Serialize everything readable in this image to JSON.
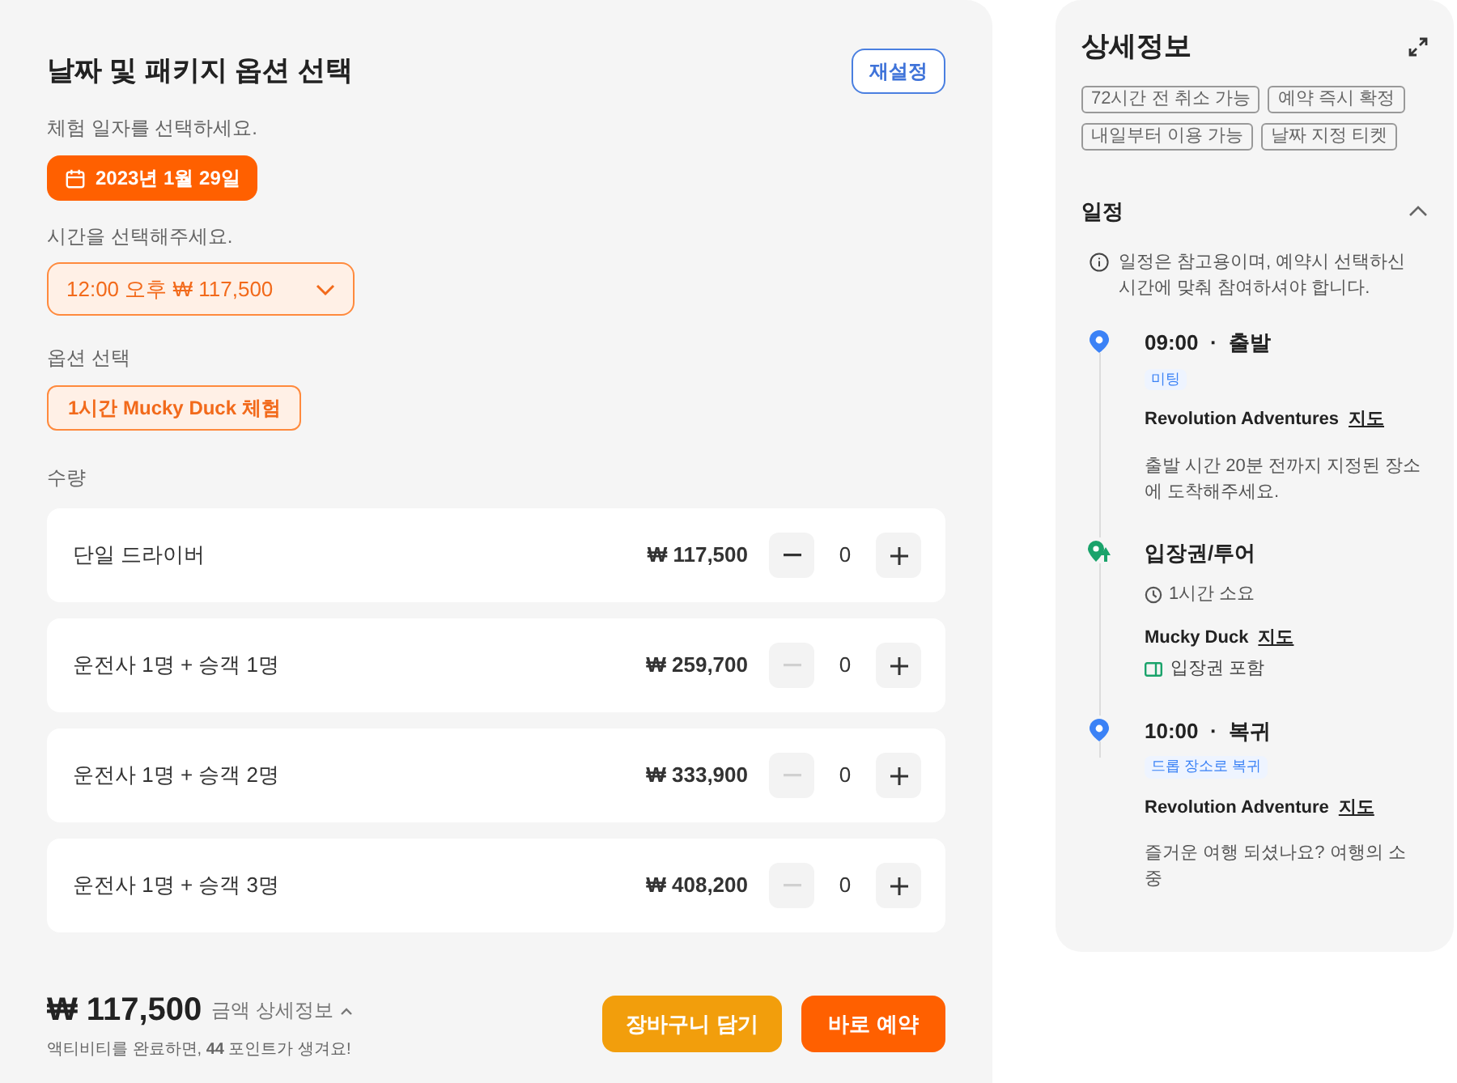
{
  "booking": {
    "title": "날짜 및 패키지 옵션 선택",
    "reset_button": "재설정",
    "date_label": "체험 일자를 선택하세요.",
    "date": "2023년 1월 29일",
    "time_label": "시간을 선택해주세요.",
    "time_select": "12:00 오후 ₩ 117,500",
    "option_label": "옵션 선택",
    "options": [
      {
        "label": "1시간 Mucky Duck 체험",
        "selected": true
      }
    ],
    "quantity_label": "수량",
    "quantities": [
      {
        "name": "단일 드라이버",
        "price": "₩ 117,500",
        "count": "0",
        "minus_disabled": false
      },
      {
        "name": "운전사 1명 + 승객 1명",
        "price": "₩ 259,700",
        "count": "0",
        "minus_disabled": true
      },
      {
        "name": "운전사 1명 + 승객 2명",
        "price": "₩ 333,900",
        "count": "0",
        "minus_disabled": true
      },
      {
        "name": "운전사 1명 + 승객 3명",
        "price": "₩ 408,200",
        "count": "0",
        "minus_disabled": true
      }
    ],
    "total": "₩ 117,500",
    "price_details": "금액 상세정보",
    "points_note": "액티비티를 완료하면, **44** 포인트가 생겨요!",
    "cart_button": "장바구니 담기",
    "book_button": "바로 예약"
  },
  "details": {
    "title": "상세정보",
    "tags": [
      "72시간 전 취소 가능",
      "예약 즉시 확정",
      "내일부터 이용 가능",
      "날짜 지정 티켓"
    ],
    "schedule_title": "일정",
    "schedule_expanded": true,
    "notice": "일정은 참고용이며, 예약시 선택하신 시간에 맞춰 참여하셔야 합니다.",
    "timeline": [
      {
        "kind": "meeting",
        "heading": "09:00  ·  출발",
        "tag": "미팅",
        "place": "Revolution Adventures",
        "map_link": "지도",
        "note": "출발 시간 20분 전까지 지정된 장소에 도착해주세요."
      },
      {
        "kind": "activity",
        "heading": "입장권/투어",
        "duration": "1시간 소요",
        "place": "Mucky Duck",
        "map_link": "지도",
        "included": "입장권 포함"
      },
      {
        "kind": "return",
        "heading": "10:00  ·  복귀",
        "tag": "드롭 장소로 복귀",
        "place": "Revolution Adventure",
        "map_link": "지도",
        "note": "즐거운 여행 되셨나요? 여행의 소중"
      }
    ]
  }
}
